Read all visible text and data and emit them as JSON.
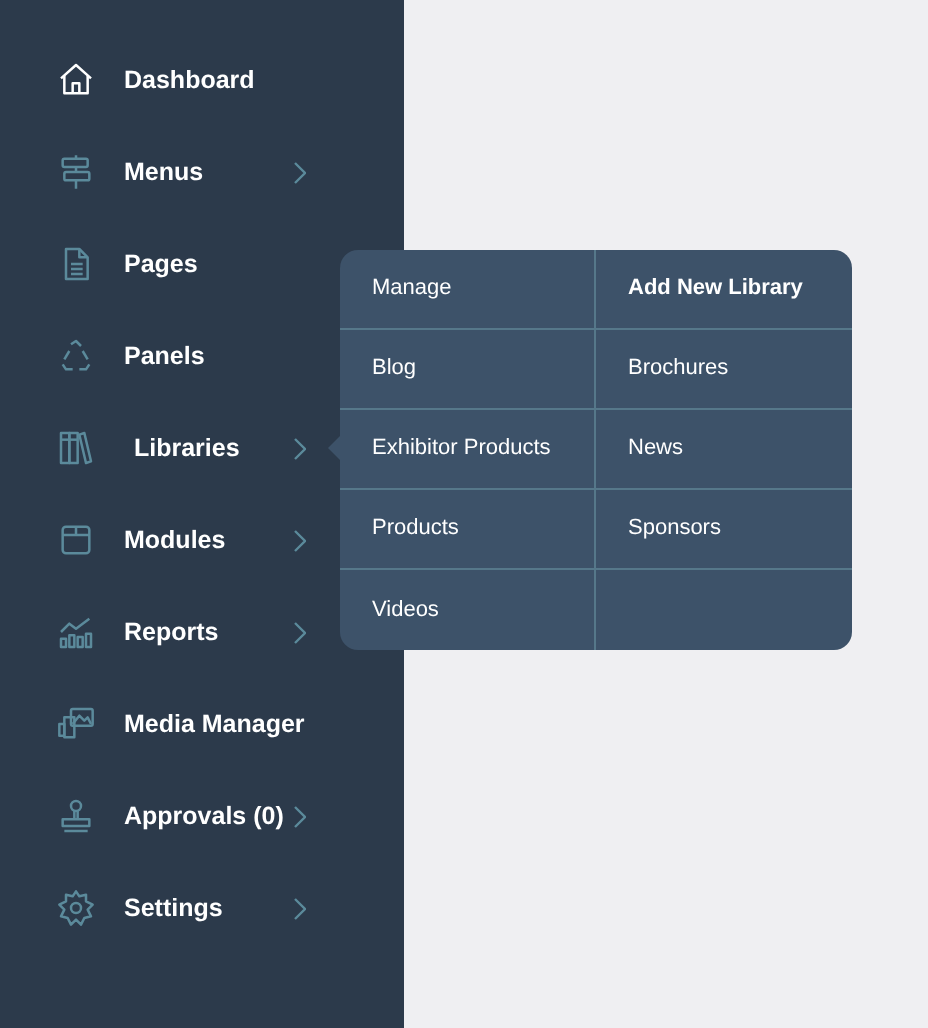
{
  "sidebar": {
    "items": [
      {
        "label": "Dashboard",
        "has_submenu": false,
        "selected": true,
        "open": false
      },
      {
        "label": "Menus",
        "has_submenu": true,
        "selected": false,
        "open": false
      },
      {
        "label": "Pages",
        "has_submenu": false,
        "selected": false,
        "open": false
      },
      {
        "label": "Panels",
        "has_submenu": false,
        "selected": false,
        "open": false
      },
      {
        "label": "Libraries",
        "has_submenu": true,
        "selected": false,
        "open": true
      },
      {
        "label": "Modules",
        "has_submenu": true,
        "selected": false,
        "open": false
      },
      {
        "label": "Reports",
        "has_submenu": true,
        "selected": false,
        "open": false
      },
      {
        "label": "Media Manager",
        "has_submenu": false,
        "selected": false,
        "open": false
      },
      {
        "label": "Approvals (0)",
        "has_submenu": true,
        "selected": false,
        "open": false
      },
      {
        "label": "Settings",
        "has_submenu": true,
        "selected": false,
        "open": false
      }
    ]
  },
  "submenu": {
    "columns": [
      [
        "Manage",
        "Blog",
        "Exhibitor Products",
        "Products",
        "Videos"
      ],
      [
        "Add New Library",
        "Brochures",
        "News",
        "Sponsors"
      ]
    ]
  }
}
